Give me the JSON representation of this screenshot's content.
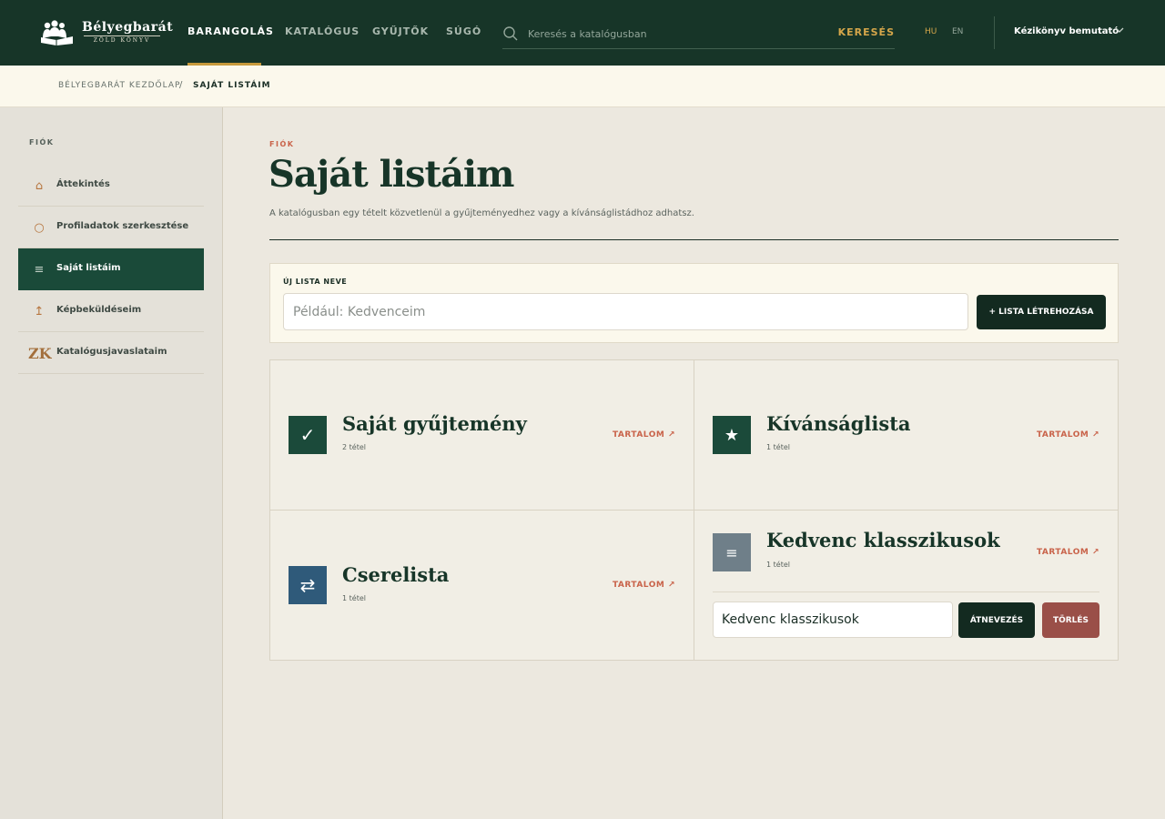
{
  "brand": {
    "title": "Bélyegbarát",
    "subtitle": "ZÖLD KÖNYV",
    "icon": "reading-family-logo-icon"
  },
  "nav": {
    "items": [
      {
        "label": "Barangolás",
        "active": true
      },
      {
        "label": "Katalógus",
        "active": false
      },
      {
        "label": "Gyűjtők",
        "active": false
      },
      {
        "label": "Súgó",
        "active": false
      }
    ]
  },
  "search": {
    "placeholder": "Keresés a katalógusban",
    "value": "",
    "button_label": "KERESÉS",
    "icon": "search-icon"
  },
  "languages": [
    {
      "code": "HU",
      "active": true
    },
    {
      "code": "EN",
      "active": false
    }
  ],
  "manual": {
    "label": "Kézikönyv bemutató",
    "icon": "chevron-down-icon"
  },
  "breadcrumb": {
    "home": "BÉLYEGBARÁT KEZDŐLAP",
    "separator": "/",
    "current": "SAJÁT LISTÁIM"
  },
  "sidebar": {
    "heading": "FIÓK",
    "items": [
      {
        "label": "Áttekintés",
        "icon": "home-icon",
        "glyph": "⌂",
        "active": false
      },
      {
        "label": "Profiladatok szerkesztése",
        "icon": "profile-circle-icon",
        "glyph": "○",
        "active": false
      },
      {
        "label": "Saját listáim",
        "icon": "list-icon",
        "glyph": "≡",
        "active": true
      },
      {
        "label": "Képbeküldéseim",
        "icon": "upload-arrow-icon",
        "glyph": "↥",
        "active": false
      },
      {
        "label": "Katalógusjavaslataim",
        "icon": "zk-monogram-icon",
        "glyph": "ZK",
        "active": false
      }
    ]
  },
  "main": {
    "kicker": "FIÓK",
    "title": "Saját listáim",
    "description": "A katalógusban egy tételt közvetlenül a gyűjteményedhez vagy a kívánságlistádhoz adhatsz."
  },
  "create": {
    "label": "ÚJ LISTA NEVE",
    "placeholder": "Például: Kedvenceim",
    "value": "",
    "button_label": "+ LISTA LÉTREHOZÁSA"
  },
  "lists": [
    {
      "title": "Saját gyűjtemény",
      "count": "2 tétel",
      "link": "TARTALOM ↗",
      "icon": "checkmark-icon",
      "glyph": "✓",
      "color": "#1b4a3a"
    },
    {
      "title": "Kívánságlista",
      "count": "1 tétel",
      "link": "TARTALOM ↗",
      "icon": "star-icon",
      "glyph": "★",
      "color": "#1b4a3a"
    },
    {
      "title": "Cserelista",
      "count": "1 tétel",
      "link": "TARTALOM ↗",
      "icon": "swap-arrows-icon",
      "glyph": "⇄",
      "color": "#2f5a7a"
    },
    {
      "title": "Kedvenc klasszikusok",
      "count": "1 tétel",
      "link": "TARTALOM ↗",
      "icon": "list-icon",
      "glyph": "≡",
      "color": "#6f7f89",
      "rename_value": "Kedvenc klasszikusok",
      "rename_label": "ÁTNEVEZÉS",
      "delete_label": "TÖRLÉS"
    }
  ],
  "colors": {
    "header_bg": "#173528",
    "accent_gold": "#d5a64a",
    "accent_coral": "#c9634a",
    "sidebar_active": "#1a4a39",
    "page_bg": "#ece8df",
    "delete_red": "#9a4f48"
  }
}
